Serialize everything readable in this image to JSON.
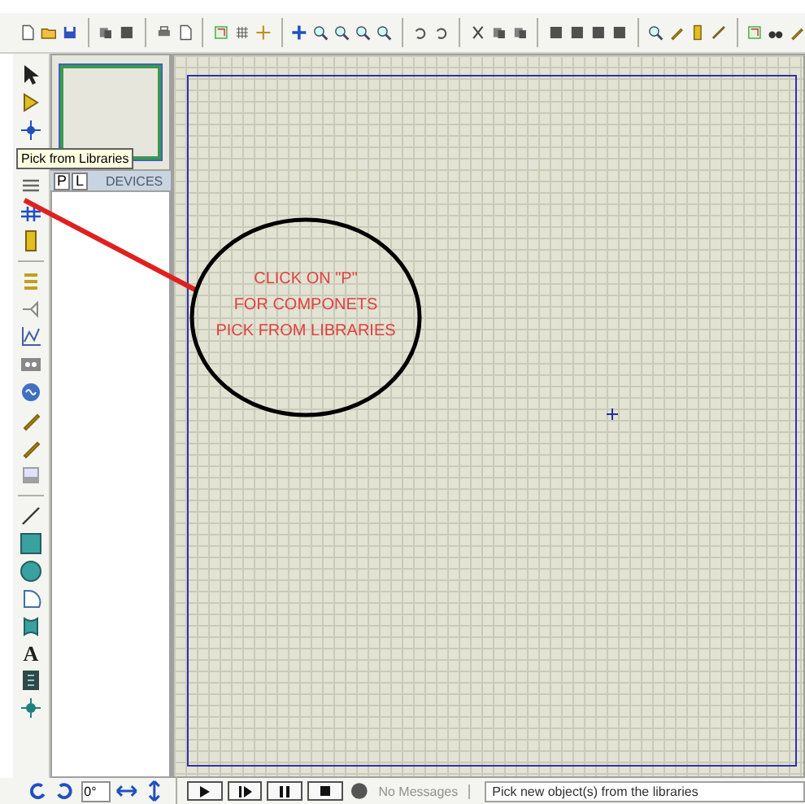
{
  "tooltip": "Pick from Libraries",
  "device_panel": {
    "buttons": [
      {
        "label": "P",
        "selected": false
      },
      {
        "label": "L",
        "selected": false
      }
    ],
    "title": "DEVICES"
  },
  "annotation": {
    "lines": [
      "CLICK ON \"P\"",
      "FOR COMPONETS",
      "PICK FROM LIBRARIES"
    ]
  },
  "text_tool_glyph": "A",
  "rotation_field": {
    "value": "0°"
  },
  "messages": "No Messages",
  "status": "Pick new object(s) from the libraries"
}
